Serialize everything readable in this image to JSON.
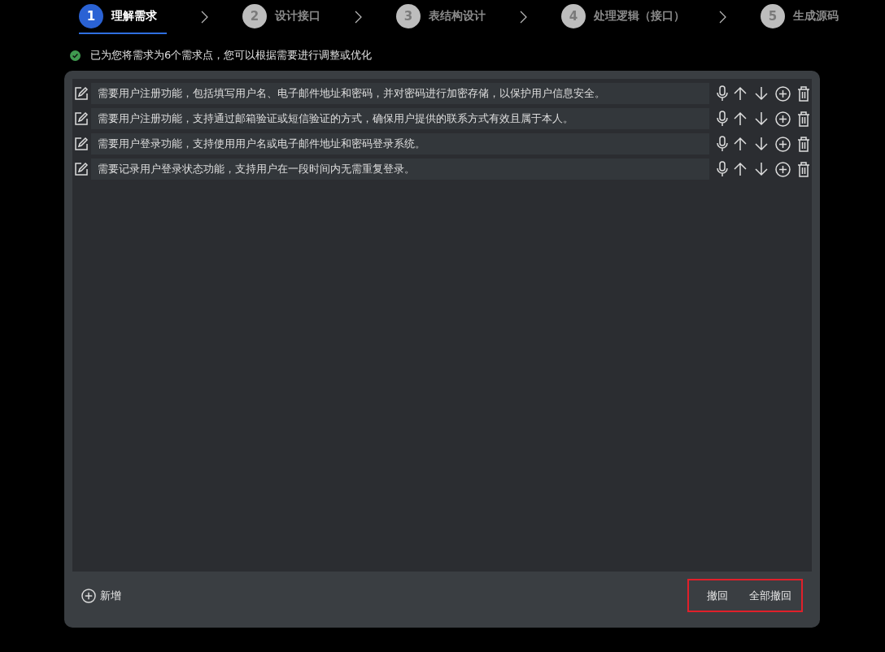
{
  "steps": [
    {
      "number": "1",
      "label": "理解需求",
      "selected": true
    },
    {
      "number": "2",
      "label": "设计接口",
      "selected": false
    },
    {
      "number": "3",
      "label": "表结构设计",
      "selected": false
    },
    {
      "number": "4",
      "label": "处理逻辑（接口）",
      "selected": false
    },
    {
      "number": "5",
      "label": "生成源码",
      "selected": false
    }
  ],
  "status": {
    "text": "已为您将需求为6个需求点，您可以根据需要进行调整或优化"
  },
  "requirements": [
    {
      "text": "需要用户注册功能，包括填写用户名、电子邮件地址和密码，并对密码进行加密存储，以保护用户信息安全。"
    },
    {
      "text": "需要用户注册功能，支持通过邮箱验证或短信验证的方式，确保用户提供的联系方式有效且属于本人。"
    },
    {
      "text": "需要用户登录功能，支持使用用户名或电子邮件地址和密码登录系统。"
    },
    {
      "text": "需要记录用户登录状态功能，支持用户在一段时间内无需重复登录。"
    }
  ],
  "footer": {
    "add_label": "新增",
    "undo_label": "撤回",
    "undo_all_label": "全部撤回"
  }
}
